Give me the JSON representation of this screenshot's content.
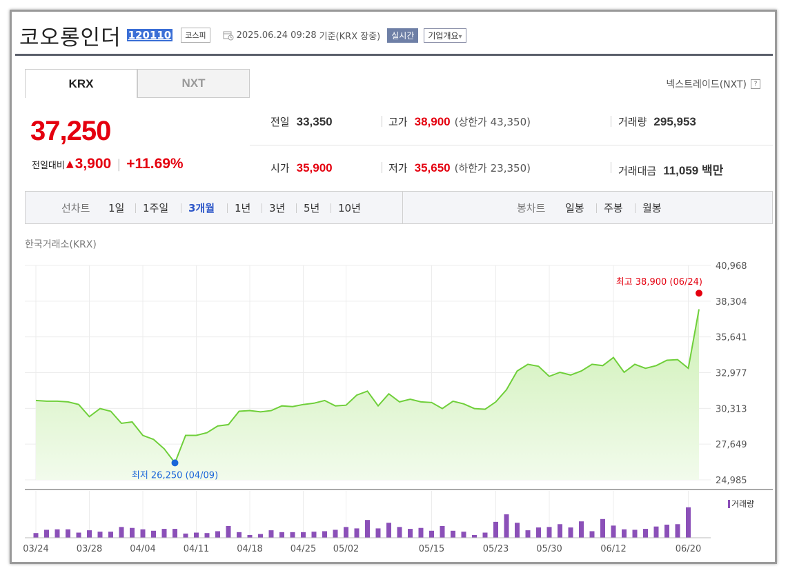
{
  "header": {
    "name": "코오롱인더",
    "code": "120110",
    "market": "코스피",
    "datetime": "2025.06.24 09:28",
    "basis": "기준(KRX 장중)",
    "realtime_label": "실시간",
    "company_label": "기업개요",
    "company_arrow": "▾"
  },
  "tabs": [
    "KRX",
    "NXT"
  ],
  "nxt_link": "넥스트레이드(NXT)",
  "nxt_help": "?",
  "quote": {
    "price": "37,250",
    "change_label": "전일대비",
    "change_arrow": "▲",
    "change": "3,900",
    "change_sep": "|",
    "change_pct": "+11.69%",
    "prev_close": {
      "label": "전일",
      "value": "33,350"
    },
    "high": {
      "label": "고가",
      "value": "38,900",
      "limit": "(상한가 43,350)"
    },
    "volume": {
      "label": "거래량",
      "value": "295,953"
    },
    "open": {
      "label": "시가",
      "value": "35,900"
    },
    "low": {
      "label": "저가",
      "value": "35,650",
      "limit": "(하한가 23,350)"
    },
    "amount": {
      "label": "거래대금",
      "value": "11,059 백만"
    }
  },
  "periods": {
    "line_label": "선차트",
    "line": [
      "1일",
      "1주일",
      "3개월",
      "1년",
      "3년",
      "5년",
      "10년"
    ],
    "active": "3개월",
    "candle_label": "봉차트",
    "candle": [
      "일봉",
      "주봉",
      "월봉"
    ]
  },
  "exchange_label": "한국거래소(KRX)",
  "volume_legend": "거래량",
  "colors": {
    "up": "#e4000f",
    "line": "#6fcf3a",
    "area": "#d9f5c5",
    "volume": "#8b50b8",
    "active": "#2c56c8",
    "low": "#1a66d9"
  },
  "chart_data": {
    "type": "area",
    "y_ticks": [
      40968,
      38304,
      35641,
      32977,
      30313,
      27649,
      24985
    ],
    "ylim": [
      24985,
      40968
    ],
    "x_tick_labels": [
      "03/24",
      "03/28",
      "04/04",
      "04/11",
      "04/18",
      "04/25",
      "05/02",
      "05/15",
      "05/23",
      "05/30",
      "06/12",
      "06/20"
    ],
    "x_tick_index": [
      0,
      5,
      10,
      15,
      20,
      25,
      29,
      37,
      43,
      48,
      54,
      61
    ],
    "values": [
      30900,
      30850,
      30850,
      30800,
      30600,
      29700,
      30300,
      30100,
      29200,
      29300,
      28300,
      28000,
      27300,
      26250,
      28300,
      28300,
      28500,
      29000,
      29100,
      30100,
      30150,
      30050,
      30150,
      30500,
      30450,
      30600,
      30700,
      30900,
      30500,
      30550,
      31300,
      31600,
      30500,
      31400,
      30800,
      31000,
      30800,
      30750,
      30300,
      30850,
      30650,
      30300,
      30250,
      30800,
      31700,
      33100,
      33600,
      33450,
      32700,
      33000,
      32800,
      33100,
      33600,
      33500,
      34100,
      33000,
      33600,
      33300,
      33500,
      33900,
      33950,
      33300,
      37700
    ],
    "volumes": [
      0.1,
      0.17,
      0.18,
      0.18,
      0.11,
      0.16,
      0.13,
      0.13,
      0.23,
      0.21,
      0.18,
      0.15,
      0.19,
      0.19,
      0.09,
      0.11,
      0.1,
      0.14,
      0.25,
      0.12,
      0.06,
      0.08,
      0.16,
      0.12,
      0.12,
      0.12,
      0.13,
      0.14,
      0.17,
      0.23,
      0.2,
      0.38,
      0.2,
      0.32,
      0.23,
      0.19,
      0.21,
      0.15,
      0.25,
      0.15,
      0.13,
      0.06,
      0.11,
      0.34,
      0.5,
      0.32,
      0.16,
      0.22,
      0.23,
      0.29,
      0.22,
      0.35,
      0.14,
      0.4,
      0.26,
      0.18,
      0.17,
      0.19,
      0.24,
      0.28,
      0.29,
      0.65
    ],
    "high_annotation": "최고 38,900 (06/24)",
    "low_annotation": "최저 26,250 (04/09)"
  }
}
